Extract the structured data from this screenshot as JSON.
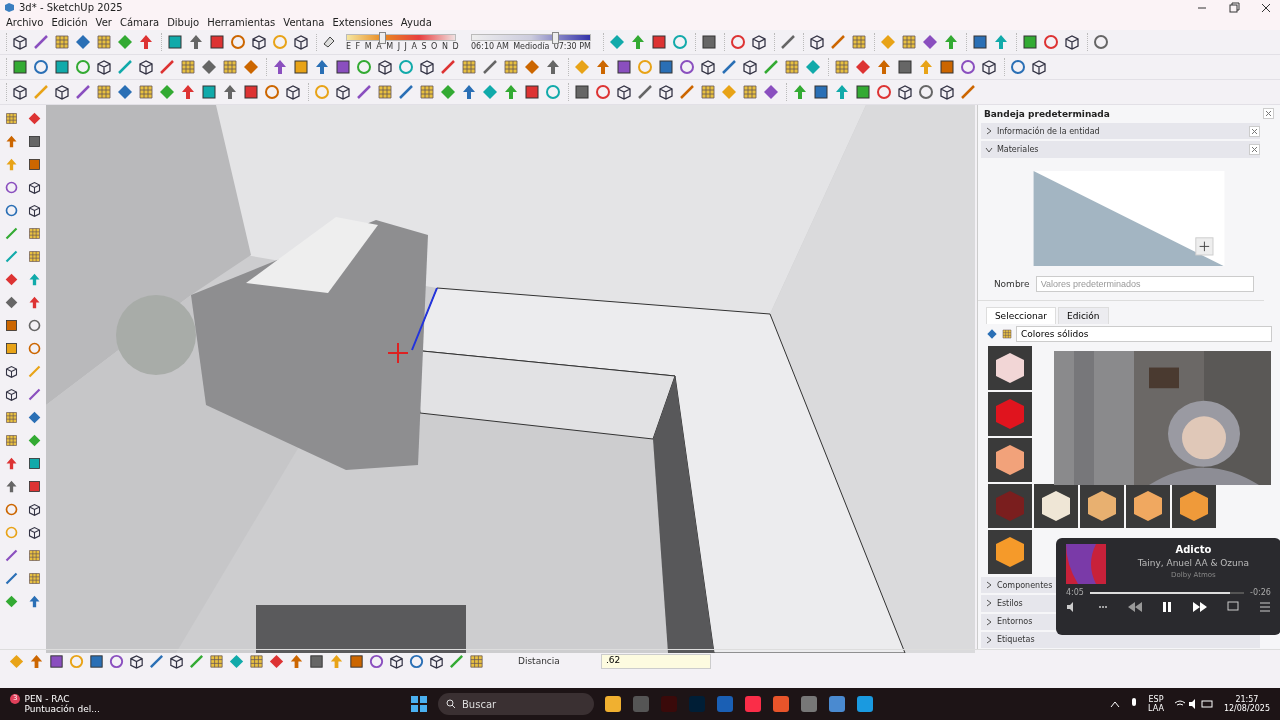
{
  "window": {
    "title": "3d* - SketchUp 2025"
  },
  "menu": [
    "Archivo",
    "Edición",
    "Ver",
    "Cámara",
    "Dibujo",
    "Herramientas",
    "Ventana",
    "Extensiones",
    "Ayuda"
  ],
  "date_slider": {
    "level": 0.3,
    "labels": "E F M A M J J A S O N D"
  },
  "time_slider": {
    "level": 0.68,
    "start": "06:10 AM",
    "middle": "Mediodía",
    "end": "07:30 PM"
  },
  "tray": {
    "title": "Bandeja predeterminada",
    "panels": [
      {
        "label": "Información de la entidad",
        "expanded": false
      },
      {
        "label": "Materiales",
        "expanded": true
      }
    ],
    "name_field": {
      "label": "Nombre",
      "placeholder": "Valores predeterminados"
    },
    "tabs": [
      {
        "label": "Seleccionar",
        "selected": true
      },
      {
        "label": "Edición",
        "selected": false
      }
    ],
    "library": "Colores sólidos",
    "swatch_rows": [
      [
        {
          "color": "#f2d6d6"
        }
      ],
      [
        {
          "color": "#e0141e"
        }
      ],
      [
        {
          "color": "#f2a27a"
        }
      ],
      [
        {
          "color": "#7a1e1e"
        },
        {
          "color": "#efe6d6"
        },
        {
          "color": "#e8b070"
        },
        {
          "color": "#f0a860"
        },
        {
          "color": "#ef9a3a"
        }
      ],
      [
        {
          "color": "#f59a2a"
        }
      ]
    ],
    "panels_below": [
      {
        "label": "Componentes",
        "expanded": false
      },
      {
        "label": "Estilos",
        "expanded": false
      },
      {
        "label": "Entornos",
        "expanded": false
      },
      {
        "label": "Etiquetas",
        "expanded": false
      }
    ]
  },
  "player": {
    "title": "Adicto",
    "artist": "Tainy, Anuel AA & Ozuna",
    "badge": "Dolby Atmos",
    "elapsed": "4:05",
    "remaining": "-0:26",
    "playing": true,
    "progress": {
      "level": 0.91
    }
  },
  "status_bar": {
    "measure_label": "Distancia",
    "measure_value": ".62"
  },
  "taskbar": {
    "notification": {
      "badge": "3",
      "title": "PEN - RAC",
      "subtitle": "Puntuación del..."
    },
    "search": {
      "placeholder": "Buscar"
    },
    "language": "ESP",
    "layout": "LAA",
    "time": "21:57",
    "date": "12/08/2025"
  }
}
